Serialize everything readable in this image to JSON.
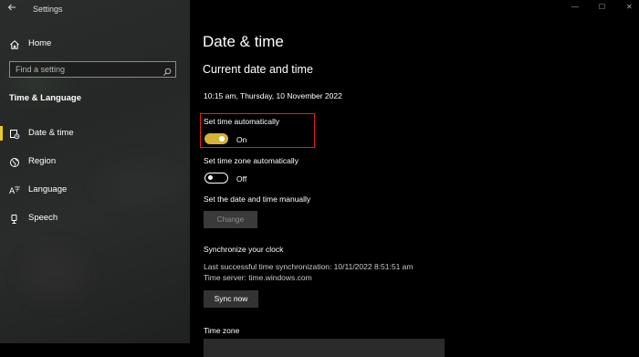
{
  "window": {
    "title": "Settings",
    "controls": {
      "minimize": "—",
      "maximize": "☐",
      "close": "✕"
    }
  },
  "sidebar": {
    "home_label": "Home",
    "search": {
      "placeholder": "Find a setting"
    },
    "section_title": "Time & Language",
    "items": [
      {
        "label": "Date & time",
        "icon": "date-time-icon",
        "selected": true
      },
      {
        "label": "Region",
        "icon": "globe-icon",
        "selected": false
      },
      {
        "label": "Language",
        "icon": "language-icon",
        "selected": false
      },
      {
        "label": "Speech",
        "icon": "microphone-icon",
        "selected": false
      }
    ]
  },
  "main": {
    "page_title": "Date & time",
    "section_title": "Current date and time",
    "current_datetime": "10:15 am, Thursday, 10 November 2022",
    "set_time_auto": {
      "label": "Set time automatically",
      "state": "On",
      "on": true
    },
    "set_tz_auto": {
      "label": "Set time zone automatically",
      "state": "Off",
      "on": false
    },
    "manual": {
      "label": "Set the date and time manually",
      "button": "Change"
    },
    "sync": {
      "title": "Synchronize your clock",
      "last_sync": "Last successful time synchronization: 10/11/2022 8:51:51 am",
      "server": "Time server: time.windows.com",
      "button": "Sync now"
    },
    "time_zone": {
      "label": "Time zone"
    }
  },
  "colors": {
    "accent": "#d4b23a",
    "highlight_box": "#e02020",
    "background": "#000000"
  }
}
